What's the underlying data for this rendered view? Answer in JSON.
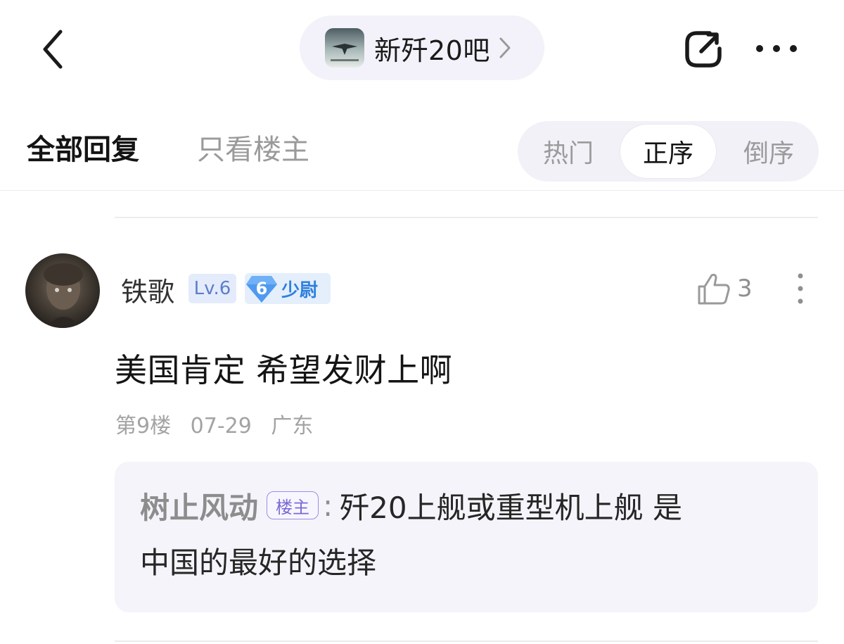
{
  "header": {
    "forum_name": "新歼20吧",
    "back_icon": "chevron-left-icon",
    "edit_icon": "edit-share-icon",
    "more_icon": "more-horizontal-icon"
  },
  "filters": {
    "tabs": [
      {
        "label": "全部回复",
        "active": true
      },
      {
        "label": "只看楼主",
        "active": false
      }
    ],
    "sort": [
      {
        "label": "热门",
        "active": false
      },
      {
        "label": "正序",
        "active": true
      },
      {
        "label": "倒序",
        "active": false
      }
    ]
  },
  "post": {
    "username": "铁歌",
    "level": "Lv.6",
    "rank_number": "6",
    "rank_title": "少尉",
    "likes": "3",
    "content": "美国肯定 希望发财上啊",
    "meta": {
      "floor": "第9楼",
      "date": "07-29",
      "location": "广东"
    },
    "quote": {
      "author": "树止风动",
      "author_tag": "楼主",
      "colon": ":",
      "text_line1": "歼20上舰或重型机上舰 是",
      "text_line2": "中国的最好的选择"
    }
  },
  "colors": {
    "accent_blue": "#2f7fe0",
    "owner_tag_purple": "#7a6ad6",
    "chip_bg": "#f3f2fa"
  }
}
